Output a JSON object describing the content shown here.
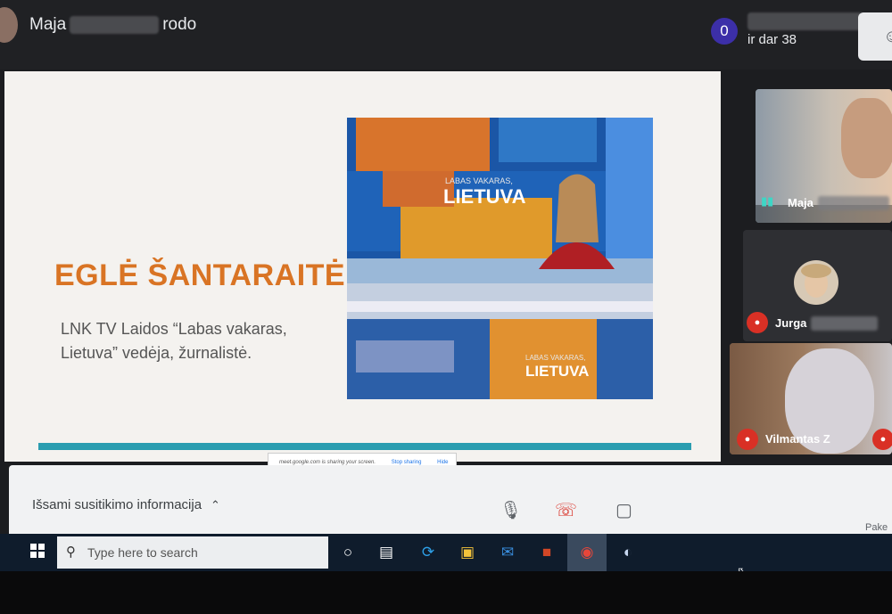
{
  "top_bar": {
    "presenter_name_start": "Maja",
    "presenter_name_end": "rodo",
    "participants_initial": "0",
    "participants_more": "ir dar 38",
    "side_icon": "people-icon"
  },
  "slide": {
    "title": "EGLĖ ŠANTARAITĖ",
    "body": "LNK TV Laidos “Labas vakaras, Lietuva” vedėja, žurnalistė.",
    "photo_logo_top_small": "LABAS VAKARAS,",
    "photo_logo_top_big": "LIETUVA",
    "photo_logo_bottom_small": "LABAS VAKARAS,",
    "photo_logo_bottom_big": "LIETUVA"
  },
  "sharing_bar": {
    "text": "meet.google.com is sharing your screen.",
    "stop": "Stop sharing",
    "hide": "Hide"
  },
  "participants": [
    {
      "name": "Maja",
      "mic": "speaking"
    },
    {
      "name": "Jurga",
      "mic": "muted"
    },
    {
      "name": "Vilmantas Z",
      "mic": "muted"
    }
  ],
  "controls": {
    "meeting_info": "Išsami susitikimo informacija",
    "leave_partial": "Pake"
  },
  "taskbar": {
    "search_placeholder": "Type here to search"
  },
  "colors": {
    "slide_title": "#d97424",
    "slide_bar": "#2a9db0",
    "participants_badge": "#3c2fa8",
    "muted_red": "#d93025"
  }
}
